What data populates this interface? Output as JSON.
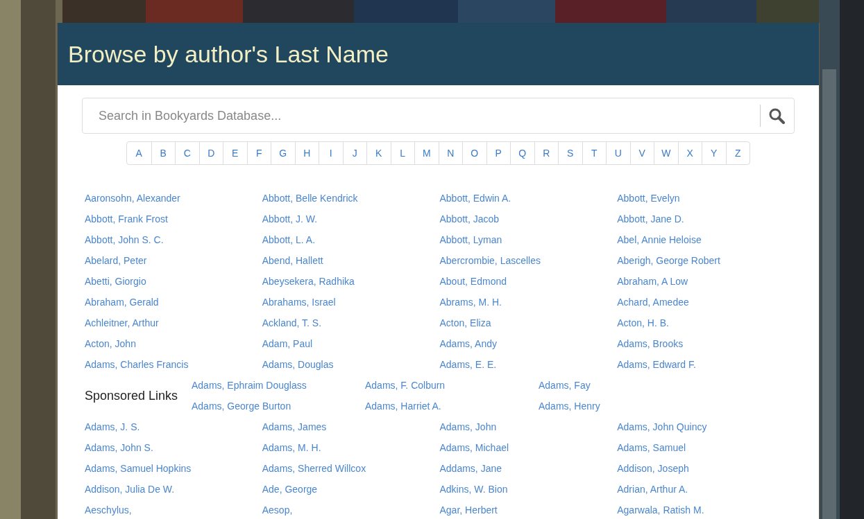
{
  "header": {
    "title": "Browse by author's Last Name"
  },
  "search": {
    "placeholder": "Search in Bookyards Database..."
  },
  "letters": [
    "A",
    "B",
    "C",
    "D",
    "E",
    "F",
    "G",
    "H",
    "I",
    "J",
    "K",
    "L",
    "M",
    "N",
    "O",
    "P",
    "Q",
    "R",
    "S",
    "T",
    "U",
    "V",
    "W",
    "X",
    "Y",
    "Z"
  ],
  "authors_top": [
    "Aaronsohn, Alexander",
    "Abbott, Belle Kendrick",
    "Abbott, Edwin A.",
    "Abbott, Evelyn",
    "Abbott, Frank Frost",
    "Abbott, J. W.",
    "Abbott, Jacob",
    "Abbott, Jane D.",
    "Abbott, John S. C.",
    "Abbott, L. A.",
    "Abbott, Lyman",
    "Abel, Annie Heloise",
    "Abelard, Peter",
    "Abend, Hallett",
    "Abercrombie, Lascelles",
    "Aberigh, George Robert",
    "Abetti, Giorgio",
    "Abeysekera, Radhika",
    "About, Edmond",
    "Abraham, A Low",
    "Abraham, Gerald",
    "Abrahams, Israel",
    "Abrams, M. H.",
    "Achard, Amedee",
    "Achleitner, Arthur",
    "Ackland, T. S.",
    "Acton, Eliza",
    "Acton, H. B.",
    "Acton, John",
    "Adam, Paul",
    "Adams, Andy",
    "Adams, Brooks",
    "Adams, Charles Francis",
    "Adams, Douglas",
    "Adams, E. E.",
    "Adams, Edward F."
  ],
  "sponsored": {
    "label": "Sponsored Links",
    "authors": [
      "Adams, Ephraim Douglass",
      "Adams, F. Colburn",
      "Adams, Fay",
      "Adams, George Burton",
      "Adams, Harriet A.",
      "Adams, Henry"
    ]
  },
  "authors_bottom": [
    "Adams, J. S.",
    "Adams, James",
    "Adams, John",
    "Adams, John Quincy",
    "Adams, John S.",
    "Adams, M. H.",
    "Adams, Michael",
    "Adams, Samuel",
    "Adams, Samuel Hopkins",
    "Adams, Sherred Willcox",
    "Addams, Jane",
    "Addison, Joseph",
    "Addison, Julia De W.",
    "Ade, George",
    "Adkins, W. Bion",
    "Adrian, Arthur A.",
    "Aeschylus,",
    "Aesop,",
    "Agar, Herbert",
    "Agarwala, Ratish M."
  ]
}
